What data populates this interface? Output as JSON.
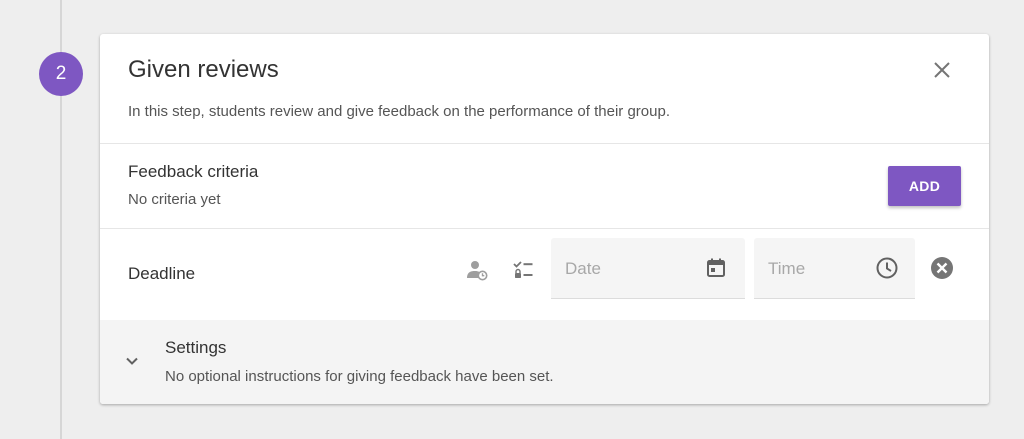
{
  "step": {
    "number": "2"
  },
  "header": {
    "title": "Given reviews",
    "description": "In this step, students review and give feedback on the performance of their group.",
    "close_icon": "close-icon"
  },
  "criteria": {
    "title": "Feedback criteria",
    "empty_text": "No criteria yet",
    "add_label": "ADD"
  },
  "deadline": {
    "label": "Deadline",
    "icons": [
      "user-clock-icon",
      "checklist-icon",
      "calendar-icon",
      "clock-icon",
      "clear-icon"
    ],
    "date": {
      "value": "",
      "placeholder": "Date"
    },
    "time": {
      "value": "",
      "placeholder": "Time"
    }
  },
  "settings": {
    "title": "Settings",
    "description": "No optional instructions for giving feedback have been set.",
    "expanded": false
  },
  "colors": {
    "accent": "#7e57c2",
    "background": "#eeeeee",
    "card": "#ffffff",
    "settings_bg": "#f4f4f4"
  }
}
